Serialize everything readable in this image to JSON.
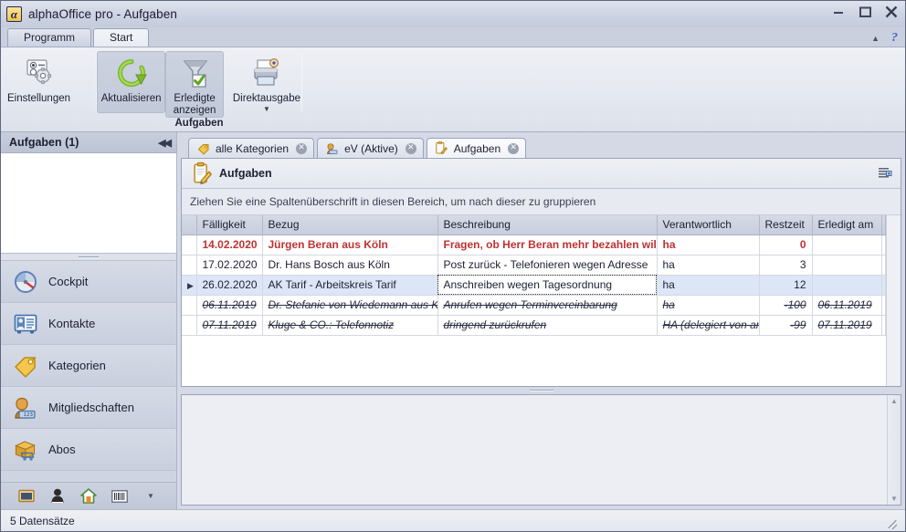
{
  "window": {
    "title": "alphaOffice pro - Aufgaben",
    "logo_glyph": "α",
    "minimize": "–",
    "maximize": "◻",
    "close": "✕"
  },
  "ribbon": {
    "tabs": [
      {
        "label": "Programm",
        "active": false
      },
      {
        "label": "Start",
        "active": true
      }
    ],
    "collapse_arrow": "▲",
    "help_label": "?",
    "groups": [
      {
        "caption": "",
        "buttons": [
          {
            "label": "Einstellungen",
            "icon": "settings-icon",
            "toggled": false,
            "dropdown": false
          }
        ]
      },
      {
        "caption": "Aufgaben",
        "buttons": [
          {
            "label": "Aktualisieren",
            "icon": "refresh-icon",
            "toggled": true,
            "dropdown": false
          },
          {
            "label": "Erledigte anzeigen",
            "icon": "filter-check-icon",
            "toggled": true,
            "dropdown": false
          },
          {
            "label": "Direktausgabe",
            "icon": "printer-preview-icon",
            "toggled": false,
            "dropdown": true,
            "caret": "▼"
          }
        ]
      }
    ]
  },
  "sidebar": {
    "header": "Aufgaben (1)",
    "collapse_glyph": "◀◀",
    "items": [
      {
        "label": "Cockpit",
        "icon": "gauge-icon"
      },
      {
        "label": "Kontakte",
        "icon": "contacts-icon"
      },
      {
        "label": "Kategorien",
        "icon": "tag-icon"
      },
      {
        "label": "Mitgliedschaften",
        "icon": "membership-icon"
      },
      {
        "label": "Abos",
        "icon": "subscriptions-icon"
      }
    ],
    "footer_icons": [
      {
        "name": "screen-icon"
      },
      {
        "name": "user-black-icon"
      },
      {
        "name": "home-icon"
      },
      {
        "name": "barcode-icon"
      },
      {
        "name": "more-dropdown-icon",
        "glyph": "▼"
      }
    ]
  },
  "doc_tabs": [
    {
      "label": "alle Kategorien",
      "icon": "tag-icon",
      "active": false,
      "close": "✕"
    },
    {
      "label": "eV (Aktive)",
      "icon": "member-icon",
      "active": false,
      "close": "✕"
    },
    {
      "label": "Aufgaben",
      "icon": "clipboard-icon",
      "active": true,
      "close": "✕"
    }
  ],
  "panel": {
    "title": "Aufgaben",
    "icon": "clipboard-pencil-icon",
    "layout_icon": "column-chooser-icon",
    "group_band_text": "Ziehen Sie eine Spaltenüberschrift in diesen Bereich, um nach dieser zu gruppieren"
  },
  "grid": {
    "columns": [
      "Fälligkeit",
      "Bezug",
      "Beschreibung",
      "Verantwortlich",
      "Restzeit",
      "Erledigt am"
    ],
    "rows": [
      {
        "indicator": "",
        "faelligkeit": "14.02.2020",
        "bezug": "Jürgen Beran aus Köln",
        "beschreibung": "Fragen, ob Herr Beran mehr bezahlen will",
        "verantwortlich": "ha",
        "restzeit": "0",
        "erledigt_am": "",
        "style": "overdue"
      },
      {
        "indicator": "",
        "faelligkeit": "17.02.2020",
        "bezug": "Dr. Hans Bosch aus Köln",
        "beschreibung": "Post zurück - Telefonieren wegen Adresse",
        "verantwortlich": "ha",
        "restzeit": "3",
        "erledigt_am": "",
        "style": "normal"
      },
      {
        "indicator": "▶",
        "faelligkeit": "26.02.2020",
        "bezug": "AK Tarif - Arbeitskreis Tarif",
        "beschreibung": "Anschreiben wegen Tagesordnung",
        "verantwortlich": "ha",
        "restzeit": "12",
        "erledigt_am": "",
        "style": "selected"
      },
      {
        "indicator": "",
        "faelligkeit": "06.11.2019",
        "bezug": "Dr. Stefanie von Wiedemann aus Köln",
        "beschreibung": "Anrufen wegen Terminvereinbarung",
        "verantwortlich": "ha",
        "restzeit": "-100",
        "erledigt_am": "06.11.2019",
        "style": "done"
      },
      {
        "indicator": "",
        "faelligkeit": "07.11.2019",
        "bezug": "Kluge & CO.: Telefonnotiz",
        "beschreibung": "dringend zurückrufen",
        "verantwortlich": "HA (delegiert von am)",
        "restzeit": "-99",
        "erledigt_am": "07.11.2019",
        "style": "done"
      }
    ]
  },
  "notes": {
    "value": "",
    "scroll_up": "▲",
    "scroll_down": "▼"
  },
  "statusbar": {
    "record_count": "5 Datensätze"
  },
  "colors": {
    "overdue_red": "#bf3232",
    "selection_blue": "#dde6f6",
    "window_chrome": "#ced4e1",
    "accent_green": "#6faf28",
    "accent_orange": "#e8a33d"
  }
}
